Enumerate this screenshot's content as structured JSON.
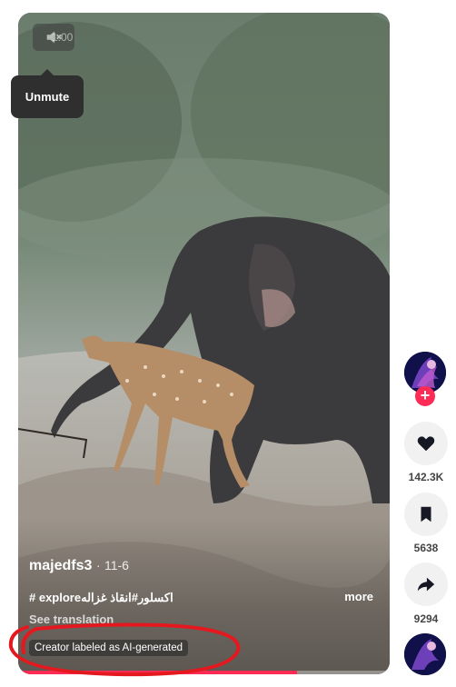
{
  "video": {
    "speed_label": "1.00",
    "tooltip": "Unmute",
    "author": "majedfs3",
    "separator": "·",
    "date": "11-6",
    "caption": "# exploreاكسلور#انقاذ غزاله",
    "more_label": "more",
    "see_translation": "See translation",
    "ai_label": "Creator labeled as AI-generated",
    "progress": 0.75
  },
  "actions": {
    "follow_symbol": "+",
    "like_count": "142.3K",
    "save_count": "5638",
    "share_count": "9294",
    "icons": [
      "heart-icon",
      "bookmark-icon",
      "share-arrow-icon"
    ]
  },
  "colors": {
    "accent": "#fe2c55",
    "annotation": "#e3191f",
    "action_bg": "#f1f1f2"
  }
}
